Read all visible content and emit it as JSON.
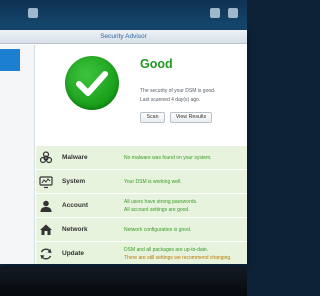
{
  "window": {
    "title": "Security Advisor"
  },
  "status": {
    "title": "Good",
    "line1": "The security of your DSM is good.",
    "line2": "Last scanned 4 day(s) ago.",
    "scan_label": "Scan",
    "results_label": "View Results"
  },
  "categories": [
    {
      "name": "Malware",
      "icon": "biohazard-icon",
      "desc1": "No malware was found on your system.",
      "desc2": ""
    },
    {
      "name": "System",
      "icon": "monitor-icon",
      "desc1": "Your DSM is working well.",
      "desc2": ""
    },
    {
      "name": "Account",
      "icon": "user-icon",
      "desc1": "All users have strong passwords.",
      "desc2": "All account settings are good."
    },
    {
      "name": "Network",
      "icon": "house-network-icon",
      "desc1": "Network configuration is good.",
      "desc2": ""
    },
    {
      "name": "Update",
      "icon": "refresh-icon",
      "desc1": "DSM and all packages are up-to-date.",
      "desc2": "There are still settings we recommend changing."
    }
  ],
  "colors": {
    "accent": "#1d7fcf",
    "good": "#1f9b1f",
    "row_bg": "#e8f3dd",
    "ok_text": "#3a9a2a",
    "warn_text": "#b77a00"
  }
}
